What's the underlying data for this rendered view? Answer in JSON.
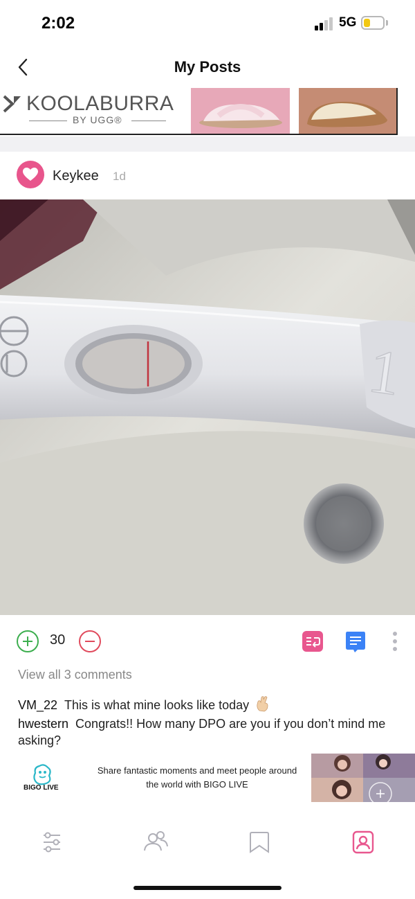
{
  "status_bar": {
    "time": "2:02",
    "network": "5G",
    "battery_level": 0.35
  },
  "header": {
    "title": "My Posts",
    "back_icon": "chevron-left-icon"
  },
  "ad_banner": {
    "brand": "KOOLABURRA",
    "brand_sub": "BY UGG®"
  },
  "post": {
    "author": "Keykee",
    "time": "1d",
    "votes": "30",
    "view_comments": "View all 3 comments",
    "comments": [
      {
        "user": "VM_22",
        "text": "This is what mine looks like today"
      },
      {
        "user": "hwestern",
        "text": "Congrats!! How many DPO are you if you don’t mind me asking?"
      }
    ]
  },
  "bottom_ad": {
    "name": "BIGO LIVE",
    "text": "Share fantastic moments and meet people around the world with BIGO LIVE"
  },
  "nav": {
    "items": [
      {
        "icon": "sliders-icon",
        "active": false
      },
      {
        "icon": "people-icon",
        "active": false
      },
      {
        "icon": "bookmark-icon",
        "active": false
      },
      {
        "icon": "profile-icon",
        "active": true
      }
    ]
  },
  "colors": {
    "accent": "#e8578e",
    "upvote": "#3cae4e",
    "downvote": "#e04a5c",
    "comment_icon": "#3b82f6",
    "muted": "#888888"
  }
}
